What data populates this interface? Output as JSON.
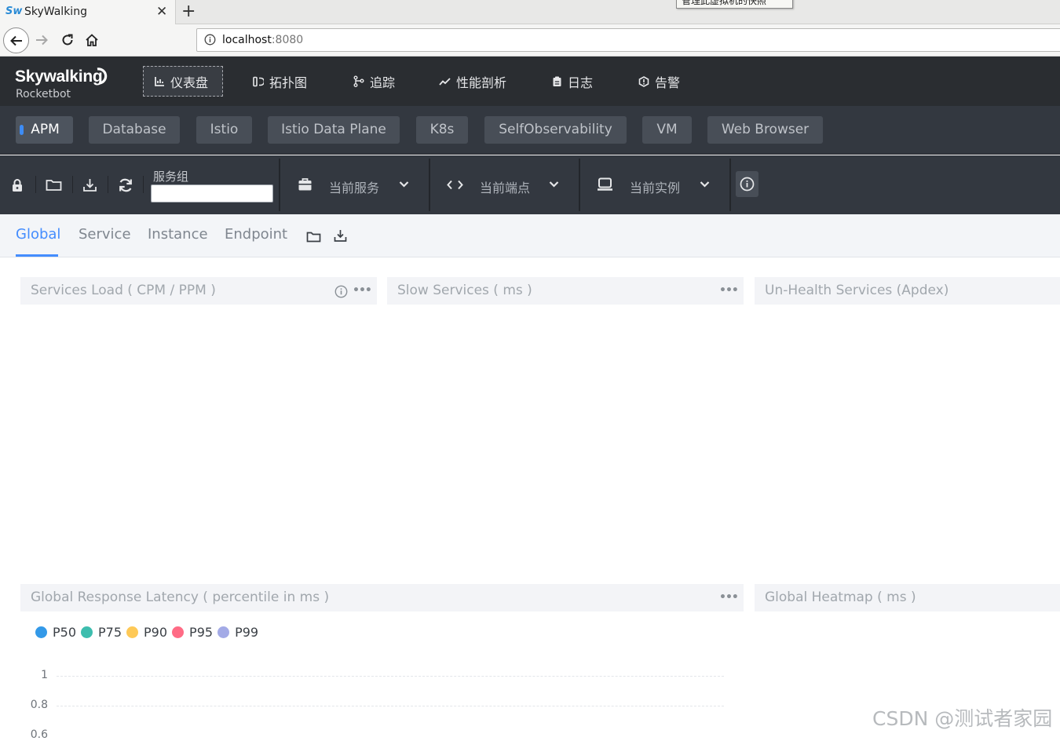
{
  "browser": {
    "tab_title": "SkyWalking",
    "favicon_text": "Sw",
    "tooltip": "管理此虚拟机的快照",
    "url_host": "localhost",
    "url_port": ":8080"
  },
  "header": {
    "logo": "Skywalking",
    "logo_sub": "Rocketbot",
    "nav": [
      {
        "label": "仪表盘",
        "icon": "dashboard-icon",
        "active": true
      },
      {
        "label": "拓扑图",
        "icon": "topology-icon"
      },
      {
        "label": "追踪",
        "icon": "trace-icon"
      },
      {
        "label": "性能剖析",
        "icon": "profile-icon"
      },
      {
        "label": "日志",
        "icon": "log-icon"
      },
      {
        "label": "告警",
        "icon": "alarm-icon"
      }
    ]
  },
  "layers": [
    {
      "label": "APM",
      "active": true
    },
    {
      "label": "Database"
    },
    {
      "label": "Istio"
    },
    {
      "label": "Istio Data Plane"
    },
    {
      "label": "K8s"
    },
    {
      "label": "SelfObservability"
    },
    {
      "label": "VM"
    },
    {
      "label": "Web Browser"
    }
  ],
  "toolbar": {
    "group_label": "服务组",
    "group_value": "",
    "service_label": "当前服务",
    "endpoint_label": "当前端点",
    "instance_label": "当前实例"
  },
  "dash_tabs": [
    {
      "label": "Global",
      "active": true
    },
    {
      "label": "Service"
    },
    {
      "label": "Instance"
    },
    {
      "label": "Endpoint"
    }
  ],
  "panels": {
    "services_load": "Services Load ( CPM / PPM )",
    "slow_services": "Slow Services ( ms )",
    "unhealth_services": "Un-Health Services (Apdex)",
    "response_latency": "Global Response Latency ( percentile in ms )",
    "heatmap": "Global Heatmap ( ms )",
    "more": "•••"
  },
  "chart_data": {
    "type": "line",
    "series": [
      {
        "name": "P50",
        "color": "#3399e8",
        "values": []
      },
      {
        "name": "P75",
        "color": "#3dbdae",
        "values": []
      },
      {
        "name": "P90",
        "color": "#fec957",
        "values": []
      },
      {
        "name": "P95",
        "color": "#ff6b85",
        "values": []
      },
      {
        "name": "P99",
        "color": "#a3aae6",
        "values": []
      }
    ],
    "yticks": [
      "1",
      "0.8",
      "0.6"
    ],
    "ylim": [
      0,
      1
    ]
  },
  "watermark": "CSDN @测试者家园"
}
